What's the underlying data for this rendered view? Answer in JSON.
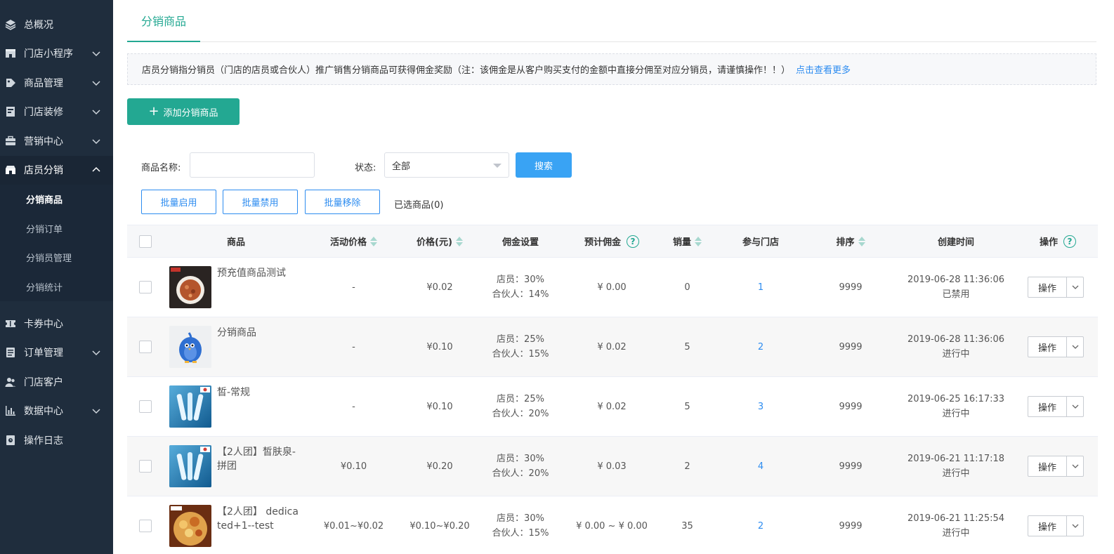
{
  "sidebar": {
    "items": [
      {
        "label": "总概况",
        "icon": "layers-icon",
        "expandable": false
      },
      {
        "label": "门店小程序",
        "icon": "store-icon",
        "expandable": true
      },
      {
        "label": "商品管理",
        "icon": "product-tag-icon",
        "expandable": true
      },
      {
        "label": "门店装修",
        "icon": "decoration-icon",
        "expandable": true
      },
      {
        "label": "营销中心",
        "icon": "briefcase-icon",
        "expandable": true
      },
      {
        "label": "店员分销",
        "icon": "shop-icon",
        "expandable": true,
        "expanded": true
      },
      {
        "label": "卡券中心",
        "icon": "ticket-icon",
        "expandable": false
      },
      {
        "label": "订单管理",
        "icon": "order-list-icon",
        "expandable": true
      },
      {
        "label": "门店客户",
        "icon": "customers-icon",
        "expandable": false
      },
      {
        "label": "数据中心",
        "icon": "bar-chart-icon",
        "expandable": true
      },
      {
        "label": "操作日志",
        "icon": "log-icon",
        "expandable": false
      }
    ],
    "sub_items": [
      "分销商品",
      "分销订单",
      "分销员管理",
      "分销统计"
    ]
  },
  "tab": {
    "label": "分销商品"
  },
  "notice": {
    "text": "店员分销指分销员（门店的店员或合伙人）推广销售分销商品可获得佣金奖励（注：该佣金是从客户购买支付的金额中直接分佣至对应分销员，请谨慎操作！！）",
    "link": "点击查看更多"
  },
  "add_button": "添加分销商品",
  "filters": {
    "name_label": "商品名称:",
    "name_value": "",
    "status_label": "状态:",
    "status_value": "全部",
    "search_button": "搜索"
  },
  "batch": {
    "enable": "批量启用",
    "disable": "批量禁用",
    "remove": "批量移除",
    "selected": "已选商品(0)"
  },
  "table": {
    "headers": {
      "product": "商品",
      "activity_price": "活动价格",
      "price": "价格(元)",
      "commission_setting": "佣金设置",
      "estimated_commission": "预计佣金",
      "sales": "销量",
      "stores": "参与门店",
      "sort": "排序",
      "created": "创建时间",
      "action": "操作"
    },
    "rows": [
      {
        "name": "预充值商品测试",
        "thumb": "food-thumb",
        "activity_price": "-",
        "price": "¥0.02",
        "staff": "店员：30%",
        "partner": "合伙人：14%",
        "est": "¥ 0.00",
        "sales": "0",
        "stores": "1",
        "sort": "9999",
        "created": "2019-06-28 11:36:06",
        "status": "已禁用",
        "action": "操作"
      },
      {
        "name": "分销商品",
        "thumb": "bird-thumb",
        "activity_price": "-",
        "price": "¥0.10",
        "staff": "店员：25%",
        "partner": "合伙人：15%",
        "est": "¥ 0.02",
        "sales": "5",
        "stores": "2",
        "sort": "9999",
        "created": "2019-06-28 11:36:06",
        "status": "进行中",
        "action": "操作"
      },
      {
        "name": "皙-常规",
        "thumb": "serum-thumb",
        "activity_price": "-",
        "price": "¥0.10",
        "staff": "店员：25%",
        "partner": "合伙人：20%",
        "est": "¥ 0.02",
        "sales": "5",
        "stores": "3",
        "sort": "9999",
        "created": "2019-06-25 16:17:33",
        "status": "进行中",
        "action": "操作"
      },
      {
        "name": "【2人团】皙肤泉-拼团",
        "thumb": "serum-thumb",
        "activity_price": "¥0.10",
        "price": "¥0.20",
        "staff": "店员：30%",
        "partner": "合伙人：20%",
        "est": "¥ 0.03",
        "sales": "2",
        "stores": "4",
        "sort": "9999",
        "created": "2019-06-21 11:17:18",
        "status": "进行中",
        "action": "操作"
      },
      {
        "name": "【2人团】 dedicated+1--test",
        "thumb": "dish-thumb",
        "activity_price": "¥0.01~¥0.02",
        "price": "¥0.10~¥0.20",
        "staff": "店员：30%",
        "partner": "合伙人：15%",
        "est": "¥ 0.00 ~ ¥ 0.00",
        "sales": "35",
        "stores": "2",
        "sort": "9999",
        "created": "2019-06-21 11:25:54",
        "status": "进行中",
        "action": "操作"
      }
    ]
  },
  "colors": {
    "sidebar_bg": "#1f2d3d",
    "accent": "#23a892",
    "search_blue": "#39a3f4",
    "link_blue": "#2d8cf0"
  }
}
